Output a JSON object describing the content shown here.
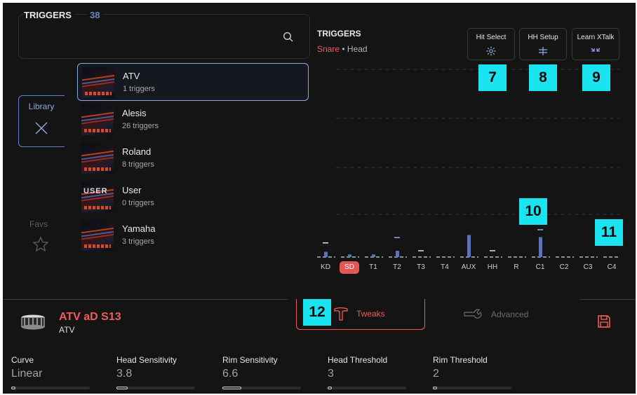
{
  "library": {
    "title": "TRIGGERS",
    "count": "38",
    "tab_library": "Library",
    "tab_favs": "Favs",
    "kits": [
      {
        "name": "ATV",
        "count": "1 triggers",
        "thumb_text": "",
        "selected": true
      },
      {
        "name": "Alesis",
        "count": "26 triggers",
        "thumb_text": ""
      },
      {
        "name": "Roland",
        "count": "8 triggers",
        "thumb_text": ""
      },
      {
        "name": "User",
        "count": "0 triggers",
        "thumb_text": "USER"
      },
      {
        "name": "Yamaha",
        "count": "3 triggers",
        "thumb_text": ""
      }
    ]
  },
  "triggers_panel": {
    "title": "TRIGGERS",
    "sub_pad": "Snare",
    "sub_sep": "•",
    "sub_zone": "Head",
    "buttons": {
      "hit_select": "Hit Select",
      "hh_setup": "HH Setup",
      "learn_xtalk": "Learn XTalk"
    },
    "badges": {
      "b7": "7",
      "b8": "8",
      "b9": "9",
      "b10": "10",
      "b11": "11",
      "b12": "12"
    },
    "channels": [
      "KD",
      "SD",
      "T1",
      "T2",
      "T3",
      "T4",
      "AUX",
      "HH",
      "R",
      "C1",
      "C2",
      "C3",
      "C4"
    ],
    "active_channel": "SD",
    "levels": [
      0.1,
      0.05,
      0.05,
      0.12,
      0.03,
      0.02,
      0.42,
      0.02,
      0.02,
      0.38,
      0.02,
      0.02,
      0.02
    ],
    "peaks": [
      0.27,
      null,
      null,
      0.37,
      0.12,
      null,
      null,
      0.12,
      null,
      0.52,
      null,
      null,
      null
    ]
  },
  "kit_info": {
    "name": "ATV aD S13",
    "brand": "ATV"
  },
  "tabs": {
    "tweaks": "Tweaks",
    "advanced": "Advanced"
  },
  "params": [
    {
      "label": "Curve",
      "value": "Linear",
      "fill": 0.05
    },
    {
      "label": "Head Sensitivity",
      "value": "3.8",
      "fill": 0.14
    },
    {
      "label": "Rim Sensitivity",
      "value": "6.6",
      "fill": 0.24
    },
    {
      "label": "Head Threshold",
      "value": "3",
      "fill": 0.05
    },
    {
      "label": "Rim Threshold",
      "value": "2",
      "fill": 0.05
    }
  ],
  "colors": {
    "accent_red": "#ef5b5b",
    "accent_blue": "#8fa7e0",
    "badge": "#19e4f0",
    "meter": "#5b74b8"
  }
}
